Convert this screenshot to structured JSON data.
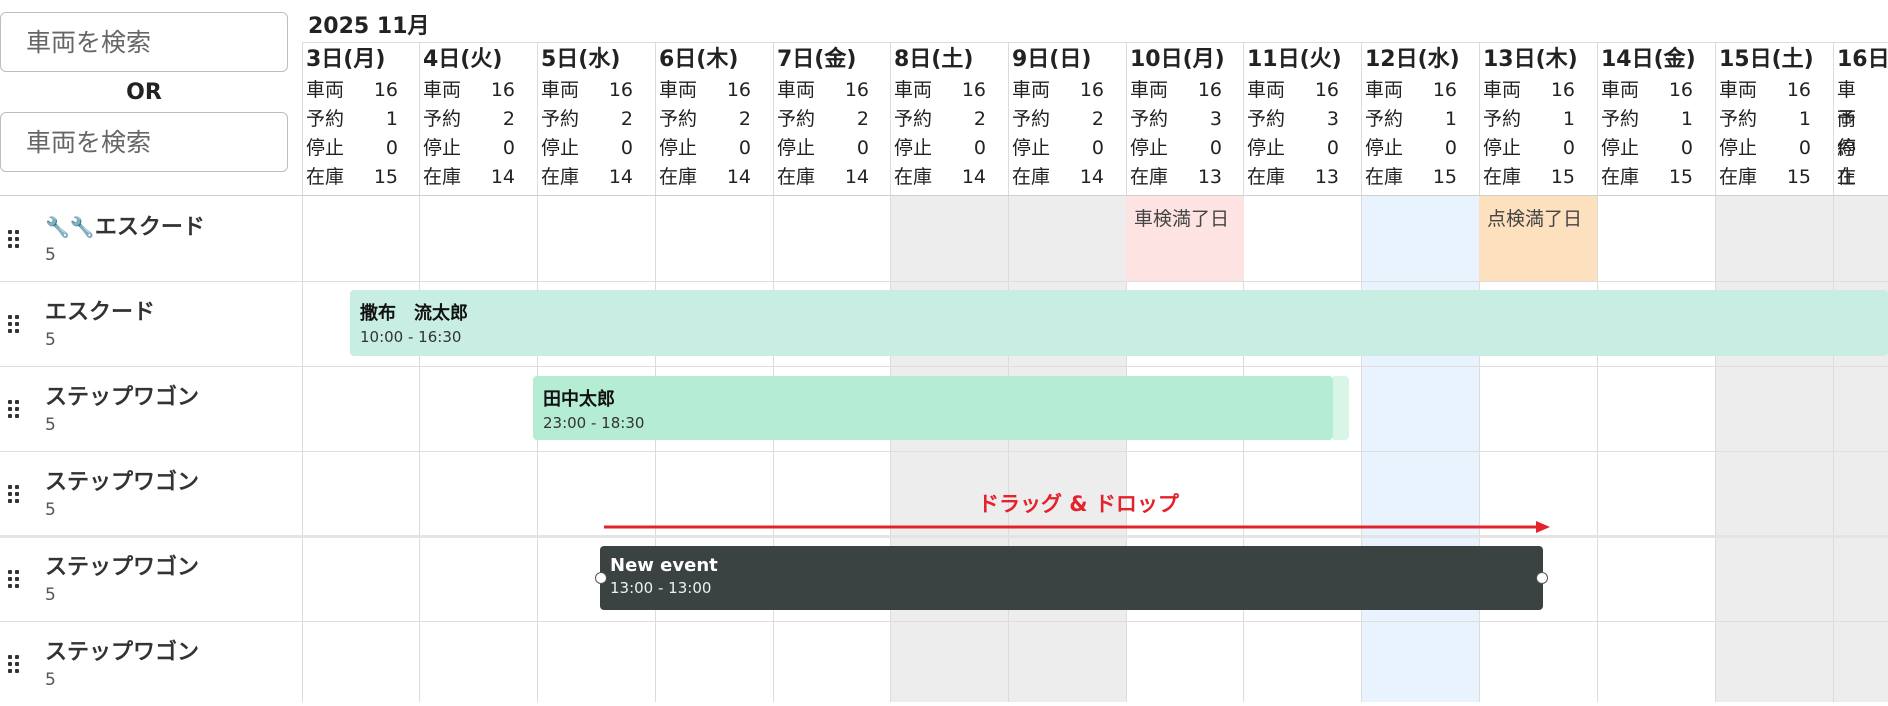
{
  "search": {
    "placeholder_1": "車両を検索",
    "or_label": "OR",
    "placeholder_2": "車両を検索"
  },
  "header": {
    "month": "2025 11月"
  },
  "stat_labels": {
    "vehicles": "車両",
    "reserved": "予約",
    "stopped": "停止",
    "stock": "在庫"
  },
  "days": [
    {
      "label": "3日(月)",
      "vehicles": "16",
      "reserved": "1",
      "stopped": "0",
      "stock": "15",
      "kind": "weekday"
    },
    {
      "label": "4日(火)",
      "vehicles": "16",
      "reserved": "2",
      "stopped": "0",
      "stock": "14",
      "kind": "weekday"
    },
    {
      "label": "5日(水)",
      "vehicles": "16",
      "reserved": "2",
      "stopped": "0",
      "stock": "14",
      "kind": "weekday"
    },
    {
      "label": "6日(木)",
      "vehicles": "16",
      "reserved": "2",
      "stopped": "0",
      "stock": "14",
      "kind": "weekday"
    },
    {
      "label": "7日(金)",
      "vehicles": "16",
      "reserved": "2",
      "stopped": "0",
      "stock": "14",
      "kind": "weekday"
    },
    {
      "label": "8日(土)",
      "vehicles": "16",
      "reserved": "2",
      "stopped": "0",
      "stock": "14",
      "kind": "weekend"
    },
    {
      "label": "9日(日)",
      "vehicles": "16",
      "reserved": "2",
      "stopped": "0",
      "stock": "14",
      "kind": "weekend"
    },
    {
      "label": "10日(月)",
      "vehicles": "16",
      "reserved": "3",
      "stopped": "0",
      "stock": "13",
      "kind": "weekday"
    },
    {
      "label": "11日(火)",
      "vehicles": "16",
      "reserved": "3",
      "stopped": "0",
      "stock": "13",
      "kind": "weekday"
    },
    {
      "label": "12日(水)",
      "vehicles": "16",
      "reserved": "1",
      "stopped": "0",
      "stock": "15",
      "kind": "today"
    },
    {
      "label": "13日(木)",
      "vehicles": "16",
      "reserved": "1",
      "stopped": "0",
      "stock": "15",
      "kind": "weekday"
    },
    {
      "label": "14日(金)",
      "vehicles": "16",
      "reserved": "1",
      "stopped": "0",
      "stock": "15",
      "kind": "weekday"
    },
    {
      "label": "15日(土)",
      "vehicles": "16",
      "reserved": "1",
      "stopped": "0",
      "stock": "15",
      "kind": "weekend"
    },
    {
      "label": "16日",
      "vehicles": "",
      "reserved": "",
      "stopped": "",
      "stock": "",
      "kind": "weekend"
    }
  ],
  "rows": [
    {
      "name": "エスクード",
      "number": "5",
      "icon": "wrench-icons"
    },
    {
      "name": "エスクード",
      "number": "5",
      "icon": ""
    },
    {
      "name": "ステップワゴン",
      "number": "5",
      "icon": ""
    },
    {
      "name": "ステップワゴン",
      "number": "5",
      "icon": ""
    },
    {
      "name": "ステップワゴン",
      "number": "5",
      "icon": ""
    },
    {
      "name": "ステップワゴン",
      "number": "5",
      "icon": ""
    }
  ],
  "badges": {
    "shaken": "車検満了日",
    "tenken": "点検満了日"
  },
  "events": [
    {
      "title": "撒布　流太郎",
      "time": "10:00 - 16:30"
    },
    {
      "title": "田中太郎",
      "time": "23:00 - 18:30"
    },
    {
      "title": "New event",
      "time": "13:00 - 13:00"
    }
  ],
  "annotation": {
    "drag_drop": "ドラッグ & ドロップ"
  },
  "colors": {
    "weekend_bg": "#ededed",
    "today_bg": "#e9f3fd",
    "event_teal": "#c8ede3",
    "event_green": "#b5ecd4",
    "event_dark": "#3b4242",
    "shaken_bg": "#fde3e1",
    "tenken_bg": "#fde0bd",
    "annotation_red": "#e3222b"
  }
}
